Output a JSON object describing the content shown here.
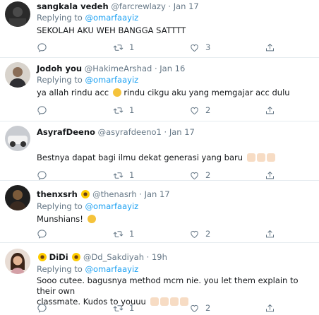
{
  "tweets": [
    {
      "name": "sangkala vedeh",
      "handle": "@farcrewlazy",
      "time": "Jan 17",
      "replying_label": "Replying to",
      "replying_to": "@omarfaayiz",
      "text": "SEKOLAH AKU WEH BANGGA SATTTT",
      "retweets": "1",
      "likes": "3"
    },
    {
      "name": "Jodoh you",
      "handle": "@HakimeArshad",
      "time": "Jan 16",
      "replying_label": "Replying to",
      "replying_to": "@omarfaayiz",
      "text_a": "ya allah rindu acc",
      "text_b": "rindu cikgu aku yang memgajar acc dulu",
      "retweets": "1",
      "likes": "2"
    },
    {
      "name": "AsyrafDeeno",
      "handle": "@asyrafdeeno1",
      "time": "Jan 17",
      "text": "Bestnya dapat bagi ilmu dekat generasi yang baru",
      "retweets": "1",
      "likes": "2"
    },
    {
      "name": "thenxsrh",
      "handle": "@thenasrh",
      "time": "Jan 17",
      "replying_label": "Replying to",
      "replying_to": "@omarfaayiz",
      "text": "Munshians!",
      "retweets": "1",
      "likes": "2"
    },
    {
      "name": "DiDi",
      "handle": "@Dd_Sakdiyah",
      "time": "19h",
      "replying_label": "Replying to",
      "replying_to": "@omarfaayiz",
      "text_line1": "Sooo cutee. bagusnya method mcm nie. you let them explain to their own",
      "text_line2": "classmate. Kudos to youuu",
      "retweets": "1",
      "likes": "2"
    }
  ],
  "icons": [
    "reply-icon",
    "retweet-icon",
    "like-icon",
    "share-icon",
    "clapping-hands-emoji",
    "sunflower-emoji",
    "crying-emoji",
    "smiling-emoji",
    "bouquet-emoji"
  ],
  "colors": {
    "accent": "#1da1f2",
    "muted": "#657786",
    "divider": "#e6ecf0"
  }
}
